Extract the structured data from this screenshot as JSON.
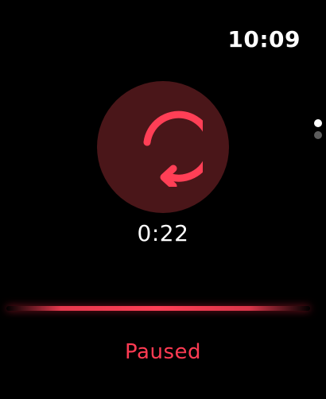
{
  "status_bar": {
    "time": "10:09"
  },
  "page_indicator": {
    "pages": 2,
    "current": 1
  },
  "recorder": {
    "resume_icon": "resume-arrow-icon",
    "elapsed": "0:22",
    "status": "Paused"
  },
  "colors": {
    "accent": "#ff3f56",
    "button_bg": "#4a1619",
    "background": "#000000"
  }
}
